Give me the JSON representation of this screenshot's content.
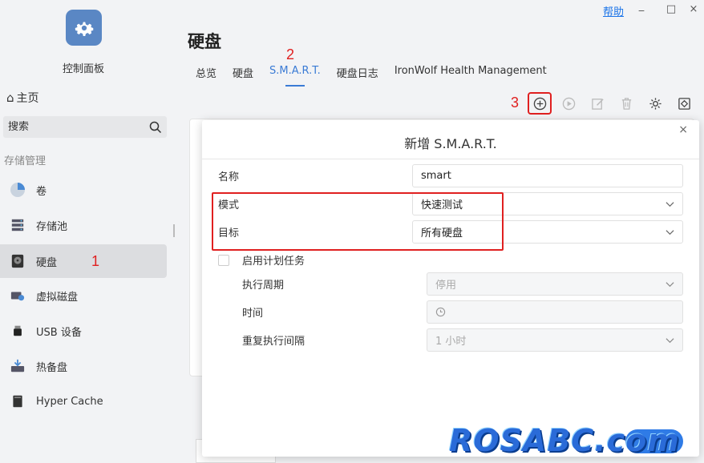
{
  "window": {
    "help_label": "帮助",
    "minimize_symbol": "_",
    "maximize_symbol": "□",
    "close_symbol": "×"
  },
  "sidebar": {
    "app_name": "控制面板",
    "app_icon": "gear-icon",
    "home_label": "主页",
    "search_placeholder": "搜索",
    "section_label": "存储管理",
    "items": [
      {
        "label": "卷",
        "icon": "pie-volume-icon"
      },
      {
        "label": "存储池",
        "icon": "storage-pool-icon"
      },
      {
        "label": "硬盘",
        "icon": "hard-disk-icon",
        "active": true
      },
      {
        "label": "虚拟磁盘",
        "icon": "virtual-disk-icon"
      },
      {
        "label": "USB 设备",
        "icon": "usb-icon"
      },
      {
        "label": "热备盘",
        "icon": "hot-spare-icon"
      },
      {
        "label": "Hyper Cache",
        "icon": "hyper-cache-icon"
      }
    ]
  },
  "main": {
    "title": "硬盘",
    "tabs": [
      {
        "label": "总览"
      },
      {
        "label": "硬盘"
      },
      {
        "label": "S.M.A.R.T.",
        "active": true
      },
      {
        "label": "硬盘日志"
      },
      {
        "label": "IronWolf Health Management"
      }
    ],
    "toolbar": [
      "add-icon",
      "play-icon",
      "edit-icon",
      "trash-icon",
      "gear-icon",
      "export-icon"
    ]
  },
  "annotations": {
    "one": "1",
    "two": "2",
    "three": "3"
  },
  "modal": {
    "title": "新增 S.M.A.R.T.",
    "close_symbol": "×",
    "name_label": "名称",
    "name_value": "smart",
    "mode_label": "模式",
    "mode_value": "快速测试",
    "target_label": "目标",
    "target_value": "所有硬盘",
    "schedule_label": "启用计划任务",
    "period_label": "执行周期",
    "period_value": "停用",
    "time_label": "时间",
    "interval_label": "重复执行间隔",
    "interval_value": "1 小时"
  },
  "watermark": "ROSABC.com",
  "colors": {
    "accent": "#3a7bd5",
    "annotation": "#e02020"
  }
}
